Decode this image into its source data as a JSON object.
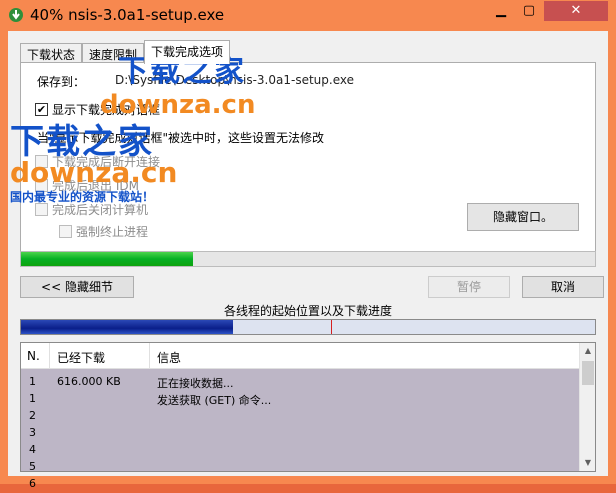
{
  "window": {
    "title": "40% nsis-3.0a1-setup.exe"
  },
  "titlebar": {
    "minimize_label": "▁",
    "maximize_label": "▢",
    "close_label": "✕"
  },
  "tabs": [
    {
      "label": "下载状态",
      "active": false
    },
    {
      "label": "速度限制",
      "active": false
    },
    {
      "label": "下载完成选项",
      "active": true
    }
  ],
  "options": {
    "save_to_label": "保存到：",
    "save_to_value": "D:\\Sysfile\\Desktop\\nsis-3.0a1-setup.exe",
    "show_dialog_label": "显示下载完成对话框",
    "show_dialog_checked": true,
    "hint": "当\"显示下载完成对话框\"被选中时，这些设置无法修改",
    "disconnect_label": "下载完成后断开连接",
    "exit_idm_label": "完成后退出 IDM",
    "shutdown_label": "完成后关闭计算机",
    "force_kill_label": "强制终止进程",
    "hide_window_button": "隐藏窗口。"
  },
  "progress": {
    "percent": 30
  },
  "buttons": {
    "hide_details": "<< 隐藏细节",
    "pause": "暂停",
    "cancel": "取消"
  },
  "threads": {
    "label": "各线程的起始位置以及下载进度",
    "segment_end": 0.37,
    "marker_pos": 0.54
  },
  "list": {
    "columns": [
      "N.",
      "已经下载",
      "信息"
    ],
    "rows": [
      {
        "n": "1",
        "downloaded": "616.000  KB",
        "info": "正在接收数据..."
      },
      {
        "n": "1",
        "downloaded": "",
        "info": "发送获取 (GET) 命令..."
      },
      {
        "n": "2",
        "downloaded": "",
        "info": ""
      },
      {
        "n": "3",
        "downloaded": "",
        "info": ""
      },
      {
        "n": "4",
        "downloaded": "",
        "info": ""
      },
      {
        "n": "5",
        "downloaded": "",
        "info": ""
      },
      {
        "n": "6",
        "downloaded": "",
        "info": ""
      }
    ]
  },
  "watermark": {
    "brand": "下载之家",
    "domain": "downza.cn",
    "slogan": "国内最专业的资源下载站！"
  },
  "colors": {
    "titlebar": "#f7884f",
    "close_button": "#c75050",
    "progress": "#06b025",
    "thread": "#0a1f8a",
    "list_bg": "#bdb6c6"
  }
}
